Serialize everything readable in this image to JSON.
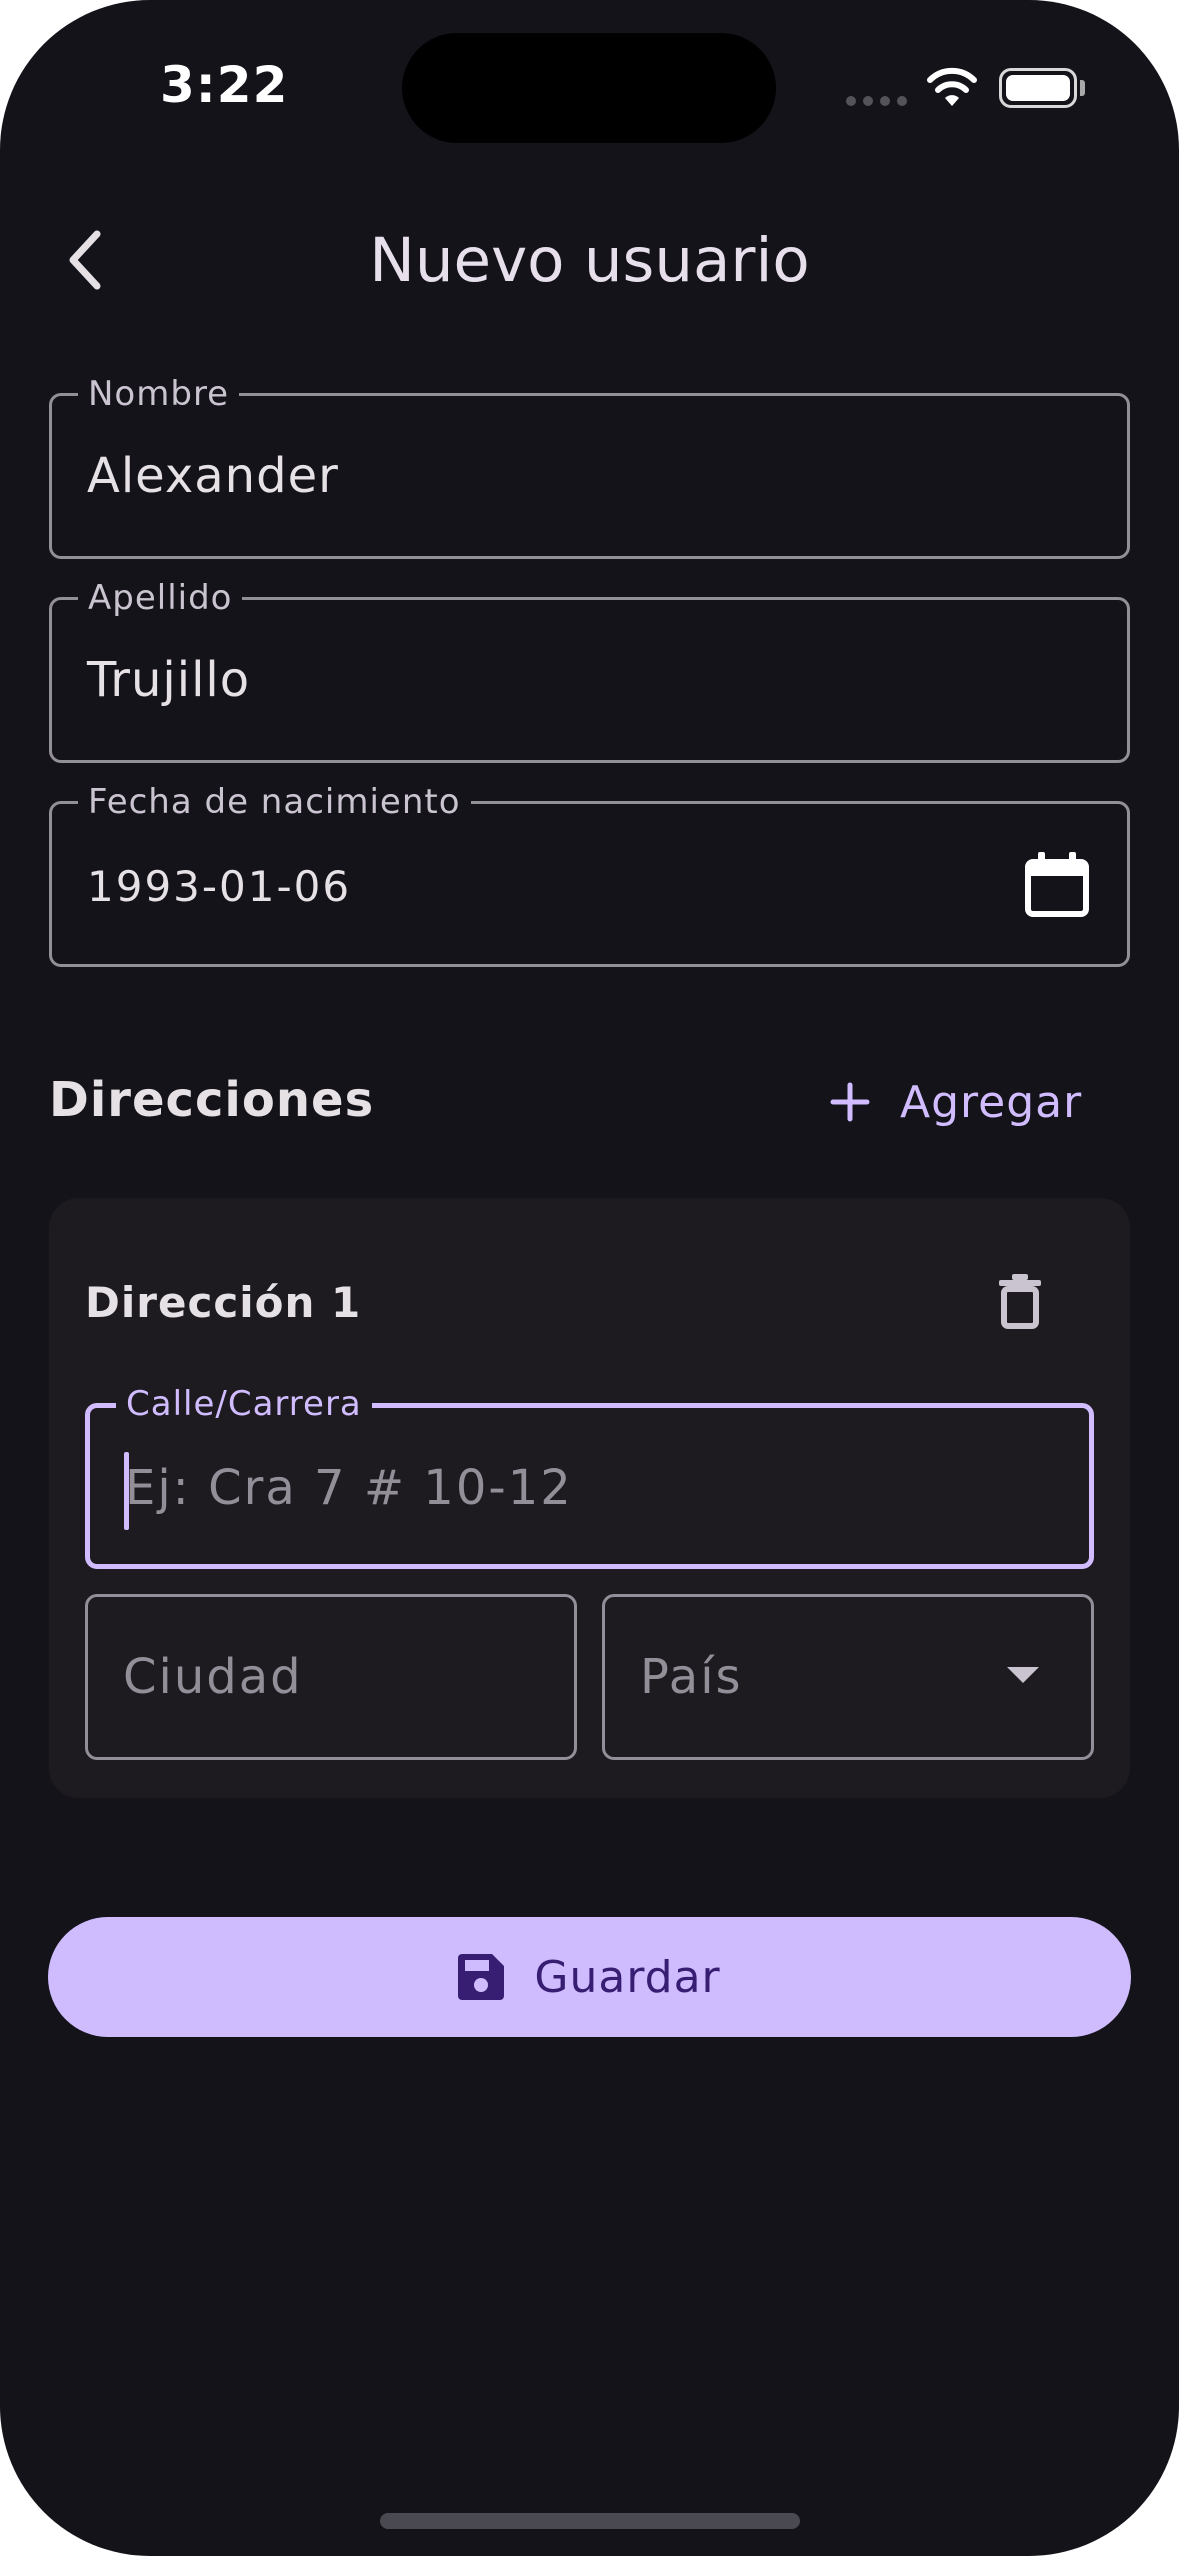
{
  "status_bar": {
    "time": "3:22"
  },
  "app_bar": {
    "title": "Nuevo usuario",
    "back_icon": "chevron-left-icon"
  },
  "form": {
    "nombre": {
      "label": "Nombre",
      "value": "Alexander"
    },
    "apellido": {
      "label": "Apellido",
      "value": "Trujillo"
    },
    "fecha_nacimiento": {
      "label": "Fecha de nacimiento",
      "value": "1993-01-06",
      "icon": "calendar-icon"
    }
  },
  "direcciones": {
    "title": "Direcciones",
    "add_label": "Agregar",
    "add_icon": "plus-icon",
    "items": [
      {
        "title": "Dirección 1",
        "delete_icon": "trash-icon",
        "calle": {
          "label": "Calle/Carrera",
          "placeholder": "Ej: Cra 7 # 10-12",
          "value": ""
        },
        "ciudad": {
          "placeholder": "Ciudad",
          "value": ""
        },
        "pais": {
          "placeholder": "País",
          "value": ""
        }
      }
    ]
  },
  "save_button": {
    "label": "Guardar",
    "icon": "save-icon"
  },
  "colors": {
    "background": "#15131a",
    "card": "#1d1b20",
    "accent": "#d0bcff",
    "button": "#cfbcff",
    "button_text": "#381e72",
    "outline": "#938f99"
  }
}
